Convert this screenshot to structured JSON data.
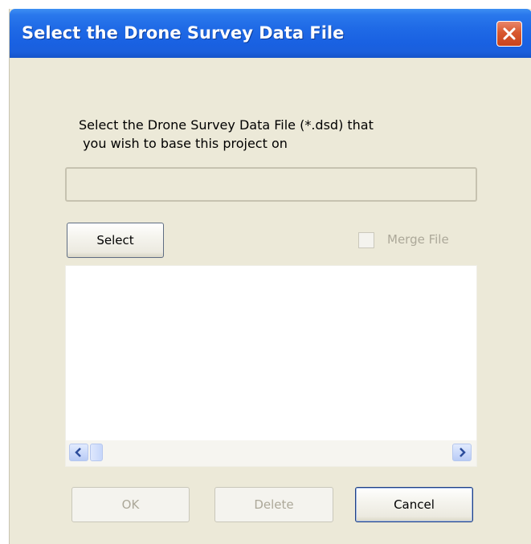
{
  "window": {
    "title": "Select the Drone Survey Data File"
  },
  "prompt": {
    "line1": "Select the Drone Survey Data File (*.dsd) that",
    "line2": " you wish to base this project on"
  },
  "file_path": {
    "value": ""
  },
  "select_button": {
    "label": "Select"
  },
  "merge_file": {
    "label": "Merge File",
    "checked": false,
    "enabled": false
  },
  "file_list": {
    "items": []
  },
  "buttons": {
    "ok": "OK",
    "delete": "Delete",
    "cancel": "Cancel"
  },
  "icons": {
    "close": "close-icon",
    "scroll_left": "scroll-left-arrow-icon",
    "scroll_right": "scroll-right-arrow-icon"
  },
  "colors": {
    "titlebar": "#1f6ae6",
    "dialog_bg": "#ece9d8",
    "close_button": "#d8582f",
    "disabled_text": "#aca899"
  }
}
